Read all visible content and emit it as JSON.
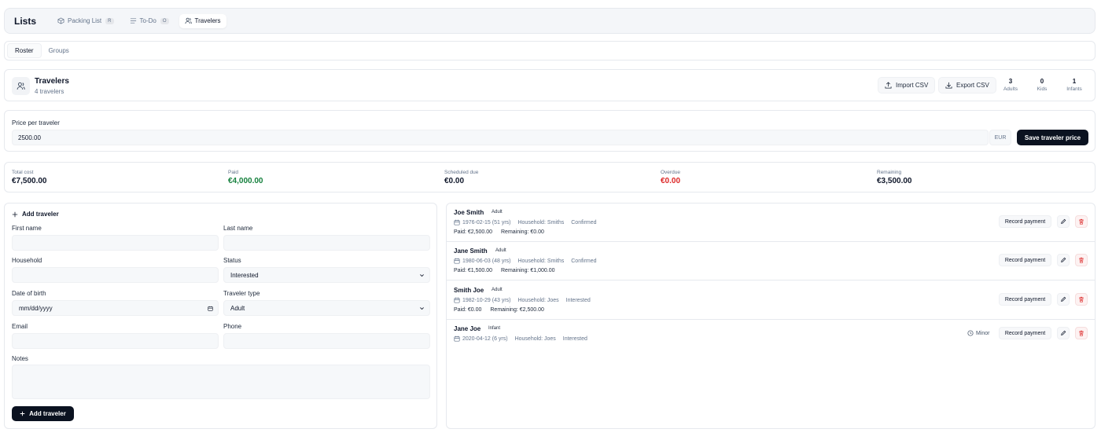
{
  "app": {
    "title": "Lists",
    "tabs": [
      {
        "label": "Packing List",
        "badge": "R"
      },
      {
        "label": "To-Do",
        "badge": "O"
      },
      {
        "label": "Travelers",
        "badge": ""
      }
    ]
  },
  "subtabs": [
    "Roster",
    "Groups"
  ],
  "header": {
    "title": "Travelers",
    "subtitle": "4 travelers",
    "import_label": "Import CSV",
    "export_label": "Export CSV",
    "stats": [
      {
        "value": "3",
        "label": "Adults"
      },
      {
        "value": "0",
        "label": "Kids"
      },
      {
        "value": "1",
        "label": "Infants"
      }
    ]
  },
  "price": {
    "label": "Price per traveler",
    "value": "2500.00",
    "currency": "EUR",
    "save_label": "Save traveler price"
  },
  "totals": [
    {
      "label": "Total cost",
      "value": "€7,500.00",
      "color": "#0f172a"
    },
    {
      "label": "Paid",
      "value": "€4,000.00",
      "color": "#15803d"
    },
    {
      "label": "Scheduled due",
      "value": "€0.00",
      "color": "#0f172a"
    },
    {
      "label": "Overdue",
      "value": "€0.00",
      "color": "#dc2626"
    },
    {
      "label": "Remaining",
      "value": "€3,500.00",
      "color": "#0f172a"
    }
  ],
  "form": {
    "title": "Add traveler",
    "first_name_label": "First name",
    "last_name_label": "Last name",
    "household_label": "Household",
    "status_label": "Status",
    "status_value": "Interested",
    "dob_label": "Date of birth",
    "dob_placeholder": "mm/dd/yyyy",
    "type_label": "Traveler type",
    "type_value": "Adult",
    "email_label": "Email",
    "phone_label": "Phone",
    "notes_label": "Notes",
    "submit_label": "Add traveler"
  },
  "travelers": [
    {
      "name": "Joe Smith",
      "type": "Adult",
      "dob": "1976-02-15 (51 yrs)",
      "household": "Household: Smiths",
      "status": "Confirmed",
      "paid": "Paid: €2,500.00",
      "remaining": "Remaining: €0.00",
      "minor": ""
    },
    {
      "name": "Jane Smith",
      "type": "Adult",
      "dob": "1980-06-03 (48 yrs)",
      "household": "Household: Smiths",
      "status": "Confirmed",
      "paid": "Paid: €1,500.00",
      "remaining": "Remaining: €1,000.00",
      "minor": ""
    },
    {
      "name": "Smith Joe",
      "type": "Adult",
      "dob": "1982-10-29 (43 yrs)",
      "household": "Household: Joes",
      "status": "Interested",
      "paid": "Paid: €0.00",
      "remaining": "Remaining: €2,500.00",
      "minor": ""
    },
    {
      "name": "Jane Joe",
      "type": "Infant",
      "dob": "2020-04-12 (6 yrs)",
      "household": "Household: Joes",
      "status": "Interested",
      "paid": "",
      "remaining": "",
      "minor": "Minor"
    }
  ],
  "record_payment_label": "Record payment",
  "icons": {
    "packing": "package-icon",
    "todo": "list-icon",
    "travelers": "users-icon",
    "import": "upload-icon",
    "export": "download-icon",
    "add": "plus-icon",
    "calendar": "calendar-icon",
    "edit": "pencil-icon",
    "delete": "trash-icon",
    "minor": "clock-icon"
  }
}
